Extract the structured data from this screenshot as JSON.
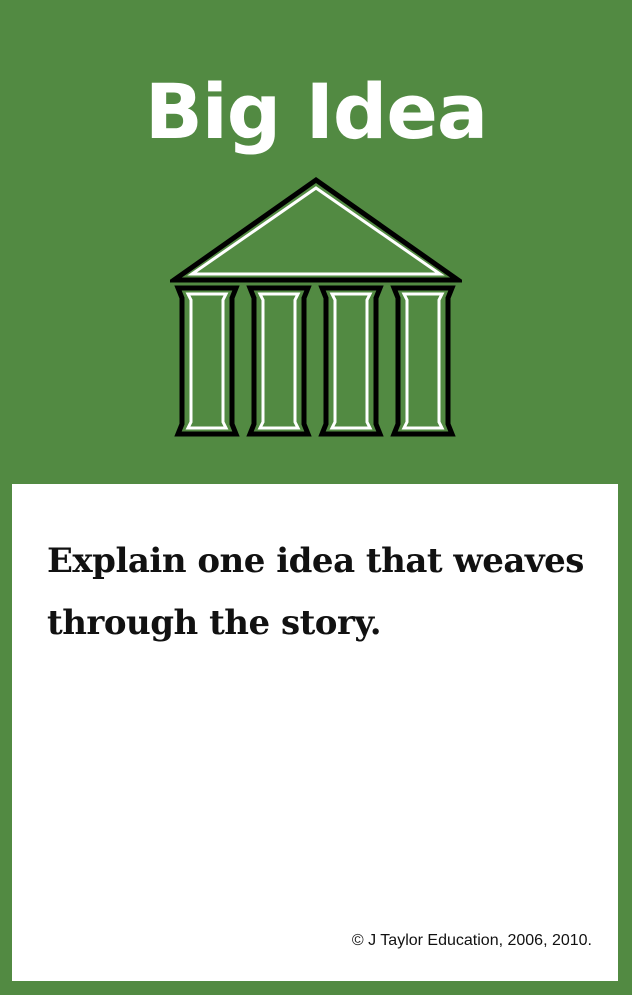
{
  "card": {
    "title": "Big Idea",
    "icon": "temple-icon",
    "prompt": "Explain one idea that weaves through the story.",
    "copyright": "© J Taylor Education, 2006, 2010."
  },
  "colors": {
    "header_background": "#528a42",
    "panel_background": "#ffffff",
    "title_text": "#ffffff",
    "body_text": "#111111"
  }
}
